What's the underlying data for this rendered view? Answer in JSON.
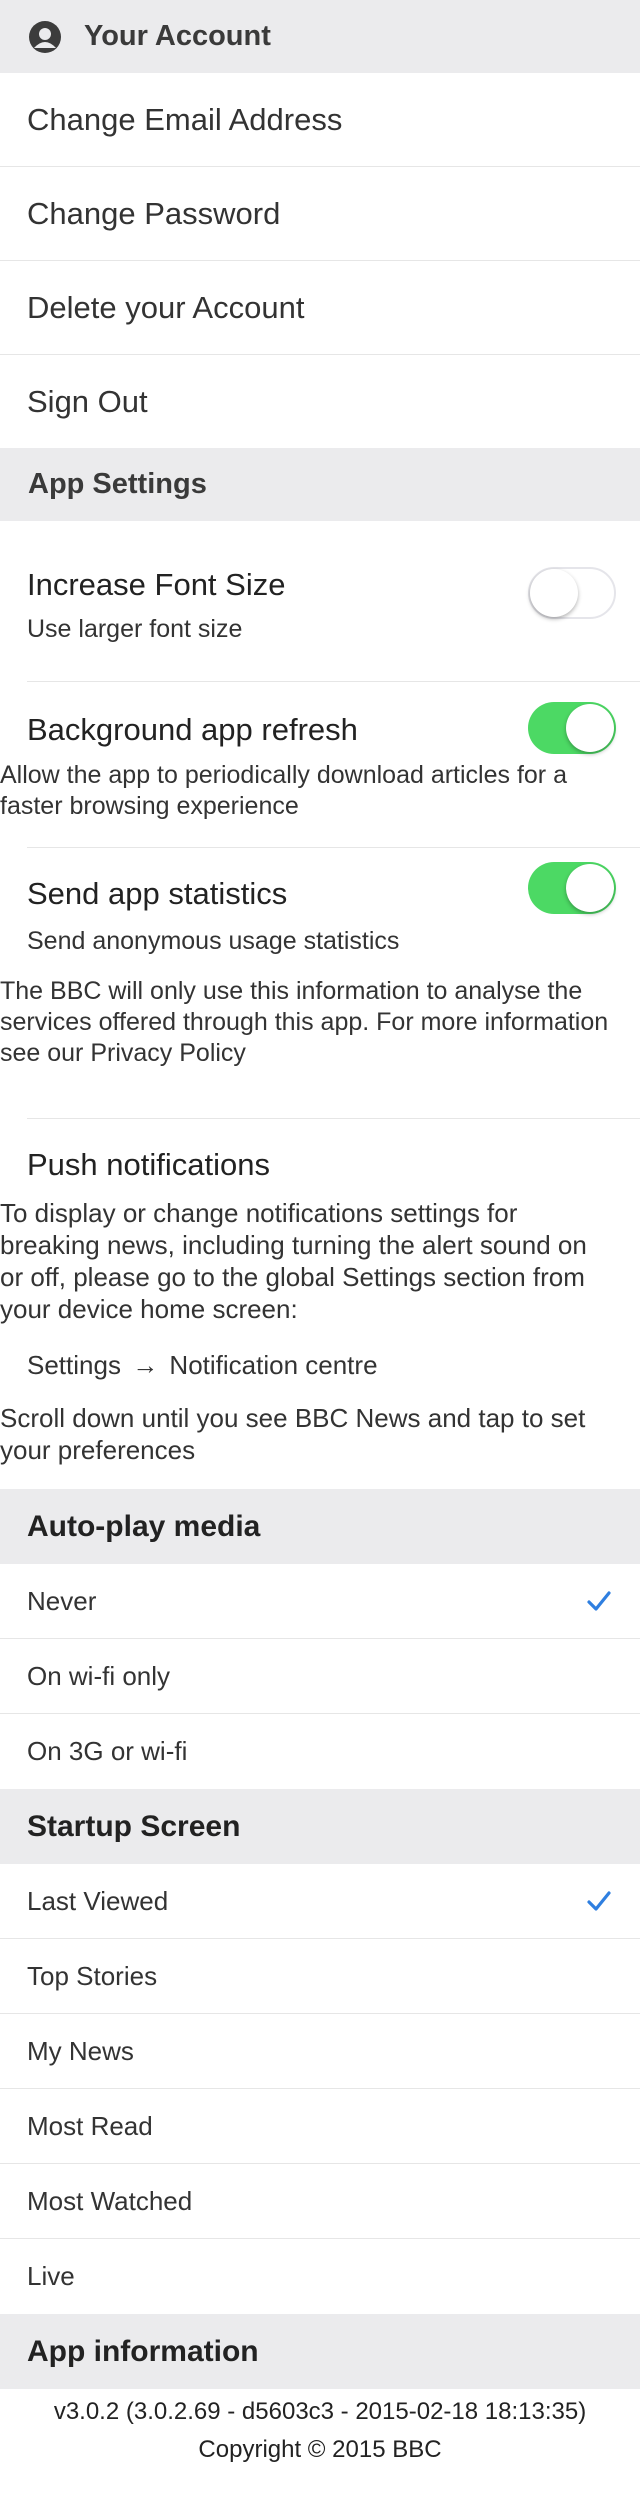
{
  "account": {
    "header": "Your Account",
    "items": [
      "Change Email Address",
      "Change Password",
      "Delete your Account",
      "Sign Out"
    ]
  },
  "app_settings": {
    "header": "App Settings",
    "font_size": {
      "title": "Increase Font Size",
      "desc": "Use larger font size",
      "enabled": false
    },
    "bg_refresh": {
      "title": "Background app refresh",
      "desc": "Allow the app to periodically download articles for a faster browsing experience",
      "enabled": true
    },
    "statistics": {
      "title": "Send app statistics",
      "desc": "Send anonymous usage statistics",
      "note": "The BBC will only use this information to analyse the services offered through this app. For more information see our Privacy Policy",
      "enabled": true
    },
    "push": {
      "title": "Push notifications",
      "desc": "To display or change notifications settings for breaking news, including turning the alert sound on or off, please go to the global Settings section from your device home screen:",
      "path_a": "Settings",
      "path_arrow": "→",
      "path_b": "Notification centre",
      "tip": "Scroll down until you see BBC News and tap to set your preferences"
    }
  },
  "autoplay": {
    "header": "Auto-play media",
    "options": [
      "Never",
      "On wi-fi only",
      "On 3G or wi-fi"
    ],
    "selected": "Never"
  },
  "startup": {
    "header": "Startup Screen",
    "options": [
      "Last Viewed",
      "Top Stories",
      "My News",
      "Most Read",
      "Most Watched",
      "Live"
    ],
    "selected": "Last Viewed"
  },
  "app_info": {
    "header": "App information",
    "version": "v3.0.2 (3.0.2.69 - d5603c3 - 2015-02-18 18:13:35)",
    "copyright": "Copyright © 2015 BBC"
  },
  "colors": {
    "accent": "#2f7fe0",
    "toggle_on": "#4cd964",
    "header_bg": "#ebebed"
  }
}
